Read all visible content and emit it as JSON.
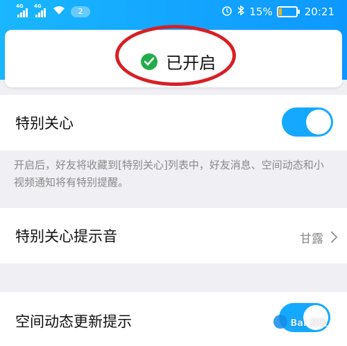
{
  "status_bar": {
    "sim1": "4G",
    "sim2": "4G",
    "notification_count": "2",
    "battery_percent": "15%",
    "battery_level": 0.15,
    "time": "20:21"
  },
  "header": {
    "status_text": "已开启"
  },
  "special_care": {
    "label": "特别关心",
    "enabled": true,
    "description": "开启后，好友将收藏到[特别关心]列表中，好友消息、空间动态和小视频通知将有特别提醒。"
  },
  "tone": {
    "label": "特别关心提示音",
    "value": "甘露"
  },
  "zone_updates": {
    "label": "空间动态更新提示",
    "enabled": true
  },
  "colors": {
    "accent": "#14a9ff",
    "success": "#22ad4b",
    "annotation": "#d81f26"
  },
  "watermark": {
    "text": "Bai 经验"
  }
}
